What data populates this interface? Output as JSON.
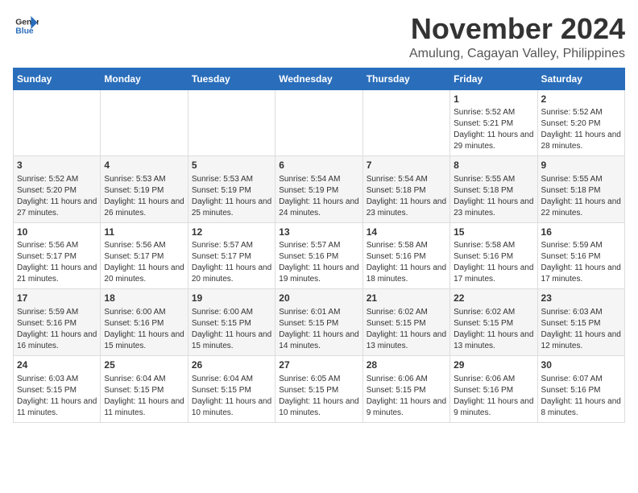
{
  "logo": {
    "line1": "General",
    "line2": "Blue"
  },
  "title": {
    "month_year": "November 2024",
    "location": "Amulung, Cagayan Valley, Philippines"
  },
  "weekdays": [
    "Sunday",
    "Monday",
    "Tuesday",
    "Wednesday",
    "Thursday",
    "Friday",
    "Saturday"
  ],
  "weeks": [
    [
      {
        "day": "",
        "info": ""
      },
      {
        "day": "",
        "info": ""
      },
      {
        "day": "",
        "info": ""
      },
      {
        "day": "",
        "info": ""
      },
      {
        "day": "",
        "info": ""
      },
      {
        "day": "1",
        "info": "Sunrise: 5:52 AM\nSunset: 5:21 PM\nDaylight: 11 hours and 29 minutes."
      },
      {
        "day": "2",
        "info": "Sunrise: 5:52 AM\nSunset: 5:20 PM\nDaylight: 11 hours and 28 minutes."
      }
    ],
    [
      {
        "day": "3",
        "info": "Sunrise: 5:52 AM\nSunset: 5:20 PM\nDaylight: 11 hours and 27 minutes."
      },
      {
        "day": "4",
        "info": "Sunrise: 5:53 AM\nSunset: 5:19 PM\nDaylight: 11 hours and 26 minutes."
      },
      {
        "day": "5",
        "info": "Sunrise: 5:53 AM\nSunset: 5:19 PM\nDaylight: 11 hours and 25 minutes."
      },
      {
        "day": "6",
        "info": "Sunrise: 5:54 AM\nSunset: 5:19 PM\nDaylight: 11 hours and 24 minutes."
      },
      {
        "day": "7",
        "info": "Sunrise: 5:54 AM\nSunset: 5:18 PM\nDaylight: 11 hours and 23 minutes."
      },
      {
        "day": "8",
        "info": "Sunrise: 5:55 AM\nSunset: 5:18 PM\nDaylight: 11 hours and 23 minutes."
      },
      {
        "day": "9",
        "info": "Sunrise: 5:55 AM\nSunset: 5:18 PM\nDaylight: 11 hours and 22 minutes."
      }
    ],
    [
      {
        "day": "10",
        "info": "Sunrise: 5:56 AM\nSunset: 5:17 PM\nDaylight: 11 hours and 21 minutes."
      },
      {
        "day": "11",
        "info": "Sunrise: 5:56 AM\nSunset: 5:17 PM\nDaylight: 11 hours and 20 minutes."
      },
      {
        "day": "12",
        "info": "Sunrise: 5:57 AM\nSunset: 5:17 PM\nDaylight: 11 hours and 20 minutes."
      },
      {
        "day": "13",
        "info": "Sunrise: 5:57 AM\nSunset: 5:16 PM\nDaylight: 11 hours and 19 minutes."
      },
      {
        "day": "14",
        "info": "Sunrise: 5:58 AM\nSunset: 5:16 PM\nDaylight: 11 hours and 18 minutes."
      },
      {
        "day": "15",
        "info": "Sunrise: 5:58 AM\nSunset: 5:16 PM\nDaylight: 11 hours and 17 minutes."
      },
      {
        "day": "16",
        "info": "Sunrise: 5:59 AM\nSunset: 5:16 PM\nDaylight: 11 hours and 17 minutes."
      }
    ],
    [
      {
        "day": "17",
        "info": "Sunrise: 5:59 AM\nSunset: 5:16 PM\nDaylight: 11 hours and 16 minutes."
      },
      {
        "day": "18",
        "info": "Sunrise: 6:00 AM\nSunset: 5:16 PM\nDaylight: 11 hours and 15 minutes."
      },
      {
        "day": "19",
        "info": "Sunrise: 6:00 AM\nSunset: 5:15 PM\nDaylight: 11 hours and 15 minutes."
      },
      {
        "day": "20",
        "info": "Sunrise: 6:01 AM\nSunset: 5:15 PM\nDaylight: 11 hours and 14 minutes."
      },
      {
        "day": "21",
        "info": "Sunrise: 6:02 AM\nSunset: 5:15 PM\nDaylight: 11 hours and 13 minutes."
      },
      {
        "day": "22",
        "info": "Sunrise: 6:02 AM\nSunset: 5:15 PM\nDaylight: 11 hours and 13 minutes."
      },
      {
        "day": "23",
        "info": "Sunrise: 6:03 AM\nSunset: 5:15 PM\nDaylight: 11 hours and 12 minutes."
      }
    ],
    [
      {
        "day": "24",
        "info": "Sunrise: 6:03 AM\nSunset: 5:15 PM\nDaylight: 11 hours and 11 minutes."
      },
      {
        "day": "25",
        "info": "Sunrise: 6:04 AM\nSunset: 5:15 PM\nDaylight: 11 hours and 11 minutes."
      },
      {
        "day": "26",
        "info": "Sunrise: 6:04 AM\nSunset: 5:15 PM\nDaylight: 11 hours and 10 minutes."
      },
      {
        "day": "27",
        "info": "Sunrise: 6:05 AM\nSunset: 5:15 PM\nDaylight: 11 hours and 10 minutes."
      },
      {
        "day": "28",
        "info": "Sunrise: 6:06 AM\nSunset: 5:15 PM\nDaylight: 11 hours and 9 minutes."
      },
      {
        "day": "29",
        "info": "Sunrise: 6:06 AM\nSunset: 5:16 PM\nDaylight: 11 hours and 9 minutes."
      },
      {
        "day": "30",
        "info": "Sunrise: 6:07 AM\nSunset: 5:16 PM\nDaylight: 11 hours and 8 minutes."
      }
    ]
  ]
}
